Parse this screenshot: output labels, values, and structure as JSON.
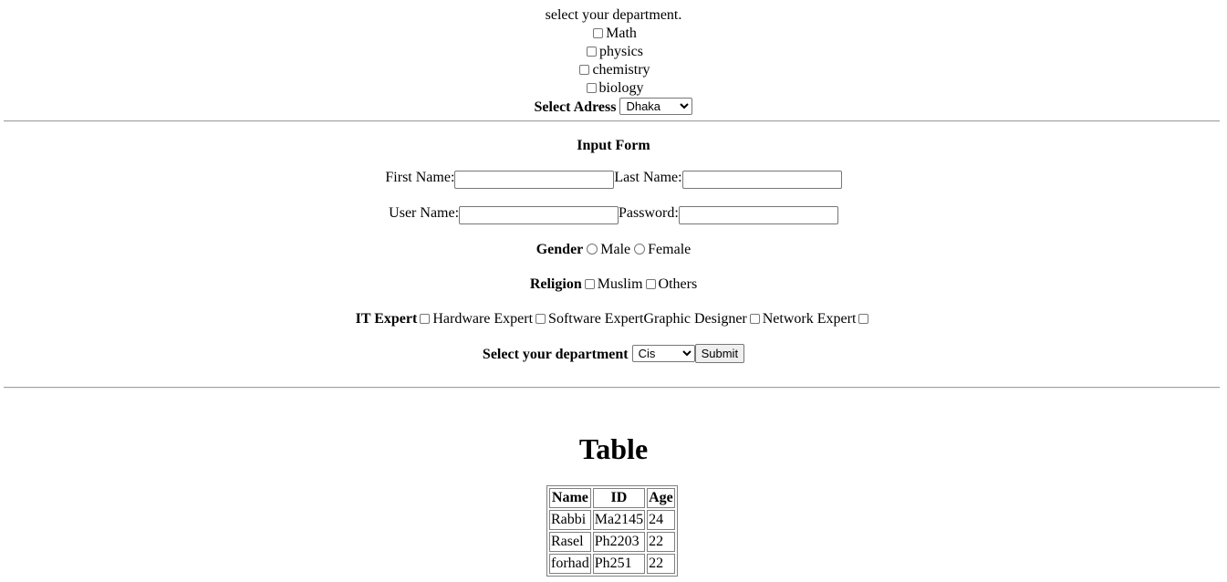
{
  "top": {
    "prompt": "select your department.",
    "departments": [
      "Math",
      "physics",
      "chemistry",
      "biology"
    ],
    "address_label": "Select Adress",
    "address_value": "Dhaka"
  },
  "form": {
    "title": "Input Form",
    "first_name_label": "First Name:",
    "last_name_label": "Last Name:",
    "user_name_label": "User Name:",
    "password_label": "Password:",
    "gender_label": "Gender",
    "gender_options": [
      "Male",
      "Female"
    ],
    "religion_label": "Religion",
    "religion_options": [
      "Muslim",
      "Others"
    ],
    "it_label": "IT Expert",
    "it_options": [
      "Hardware Expert",
      "Software Expert",
      "Graphic Designer",
      "Network Expert"
    ],
    "department_label": "Select your department",
    "department_value": "Cis",
    "submit_label": "Submit"
  },
  "table": {
    "heading": "Table",
    "columns": [
      "Name",
      "ID",
      "Age"
    ],
    "rows": [
      [
        "Rabbi",
        "Ma2145",
        "24"
      ],
      [
        "Rasel",
        "Ph2203",
        "22"
      ],
      [
        "forhad",
        "Ph251",
        "22"
      ]
    ]
  }
}
